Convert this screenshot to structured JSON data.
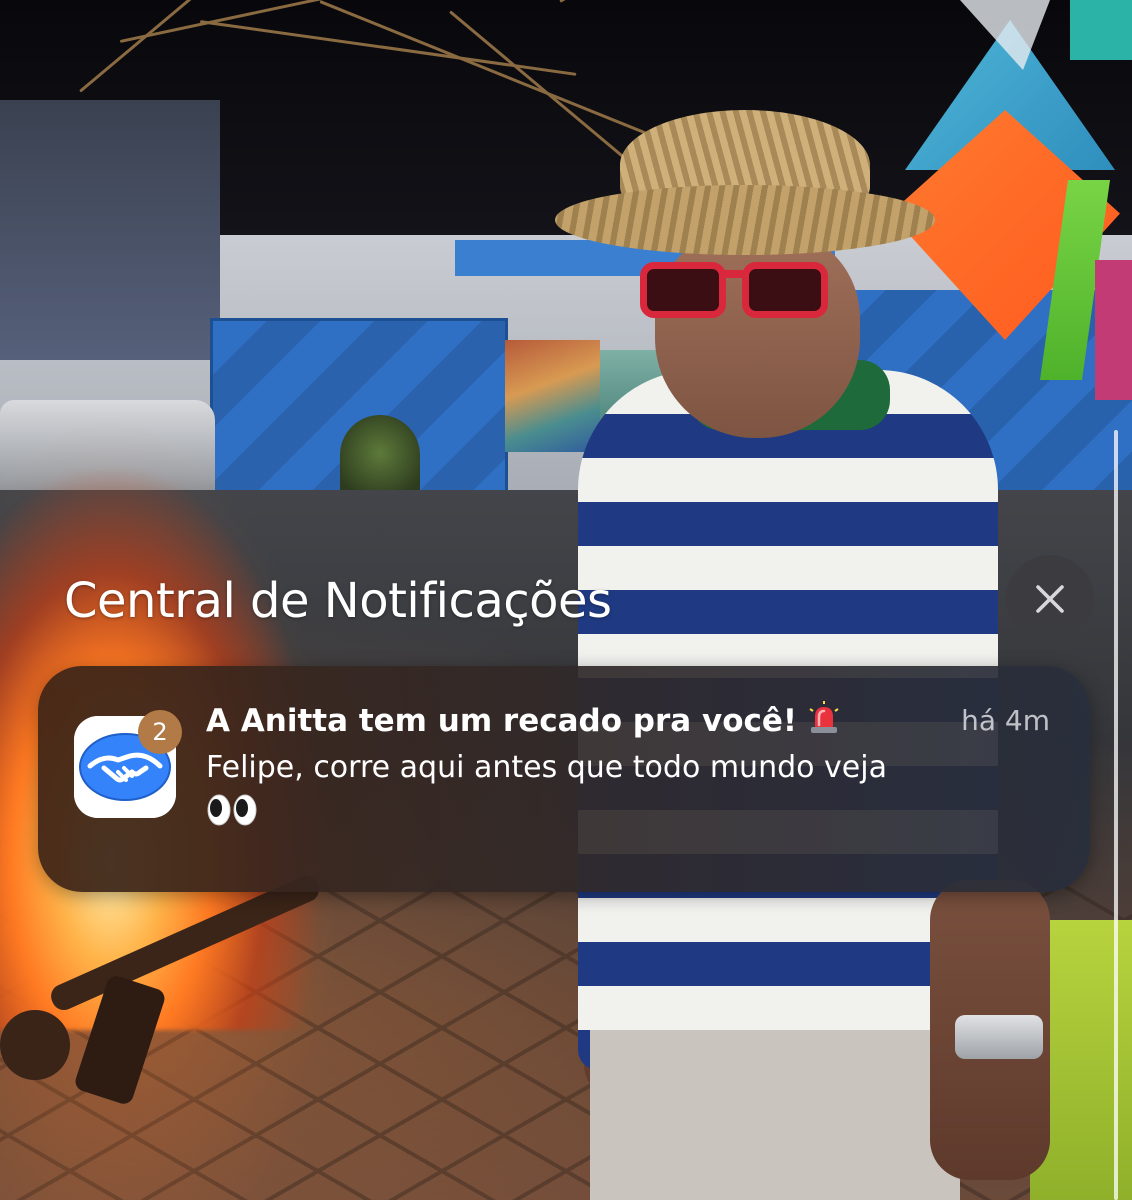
{
  "notification_center": {
    "title": "Central de Notificações",
    "clear_button_icon": "close-icon"
  },
  "notification": {
    "app_icon": "handshake-icon",
    "app_icon_color": "#3483fa",
    "badge_count": "2",
    "title": "A Anitta tem um recado pra você!",
    "title_emoji": "siren-icon",
    "time": "há 4m",
    "body": "Felipe, corre aqui antes que todo mundo veja",
    "body_emoji": "eyes-icon"
  },
  "colors": {
    "card_background": "#3a2c28",
    "badge": "#b27a46",
    "text": "#ffffff"
  }
}
